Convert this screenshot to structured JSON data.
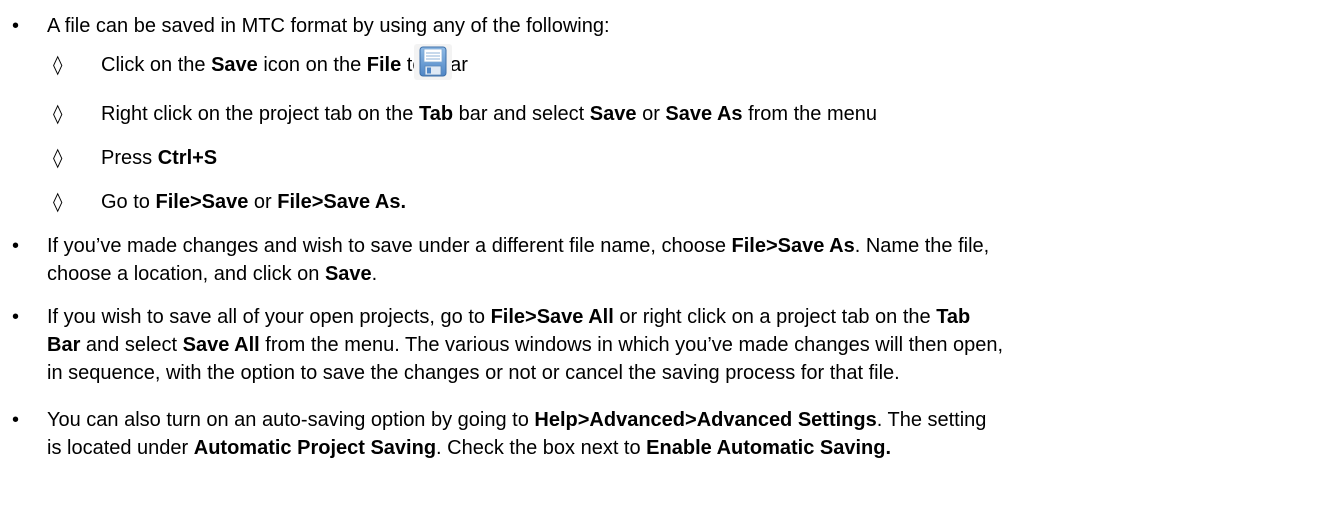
{
  "bullets": [
    {
      "text": "A file can be saved in MTC format by using any of the following:",
      "sub_items": [
        {
          "mark": "◊",
          "parts": [
            "Click on the ",
            "Save",
            " icon on the ",
            "File",
            " toolbar"
          ],
          "icon": "save-floppy-icon"
        },
        {
          "mark": "◊",
          "parts": [
            "Right click on the project tab on the ",
            "Tab",
            " bar and select ",
            "Save",
            " or ",
            "Save As",
            " from the menu"
          ]
        },
        {
          "mark": "◊",
          "parts": [
            "Press ",
            "Ctrl+S"
          ]
        },
        {
          "mark": "◊",
          "parts": [
            "Go to ",
            "File>Save",
            " or ",
            "File>Save As."
          ]
        }
      ]
    },
    {
      "line1": [
        "If you’ve made changes and wish to save under a different file name, choose ",
        "File>Save As",
        ". Name the file,"
      ],
      "line2": [
        "choose a location, and click on ",
        "Save",
        "."
      ]
    },
    {
      "line1": [
        "If you wish to save all of your open projects, go to ",
        "File>Save All",
        " or right click on a project tab on the ",
        "Tab"
      ],
      "line2": [
        "Bar",
        " and select ",
        "Save All",
        " from the menu. The various windows in which you’ve made changes will then open,"
      ],
      "line3": "in sequence, with the option to save the changes or not or cancel the saving process for that file."
    },
    {
      "line1": [
        "You can also turn on an auto-saving option by going to ",
        "Help>Advanced>Advanced Settings",
        ". The setting"
      ],
      "line2": [
        "is located under ",
        "Automatic Project Saving",
        ".  Check the box next to ",
        "Enable Automatic Saving."
      ]
    }
  ],
  "colors": {
    "text": "#000000",
    "icon_blue": "#6a9fd4"
  }
}
